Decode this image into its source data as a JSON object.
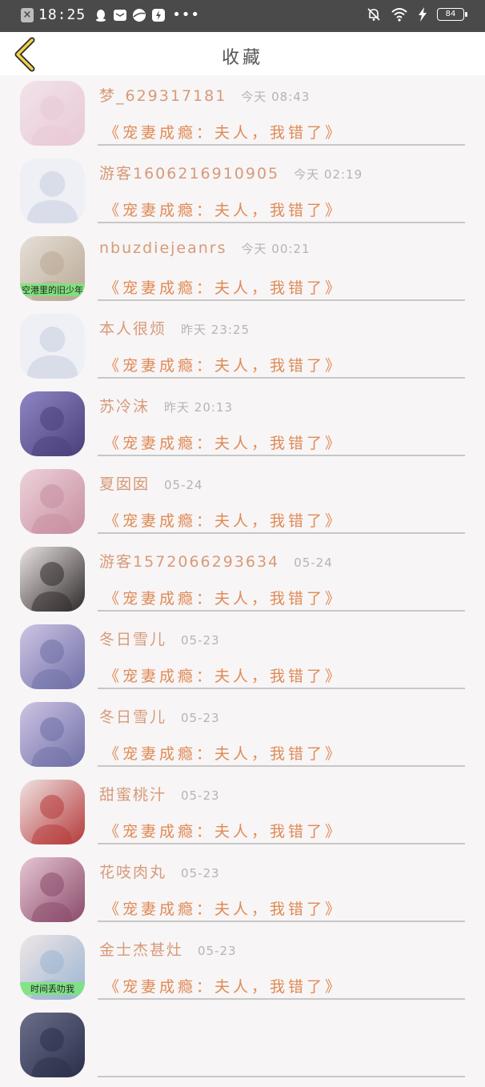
{
  "status_bar": {
    "time": "18:25",
    "battery": "84",
    "left_icons": [
      "close-box-icon",
      "qq-icon",
      "mail-icon",
      "planet-icon",
      "bolt-app-icon",
      "more-dots-icon"
    ],
    "right_icons": [
      "bell-off-icon",
      "wifi-icon",
      "charging-icon",
      "battery-icon"
    ]
  },
  "header": {
    "title": "收藏"
  },
  "items": [
    {
      "name": "梦_629317181",
      "time": "今天 08:43",
      "book": "《宠妻成瘾：夫人，我错了》",
      "avatar": "photo",
      "avatar_colors": [
        "#e8c9d6",
        "#f2e3ea"
      ]
    },
    {
      "name": "游客1606216910905",
      "time": "今天 02:19",
      "book": "《宠妻成瘾：夫人，我错了》",
      "avatar": "default",
      "avatar_colors": [
        "#d9dde9",
        "#eef0f6"
      ]
    },
    {
      "name": "nbuzdiejeanrs",
      "time": "今天 00:21",
      "book": "《宠妻成瘾：夫人，我错了》",
      "avatar": "photo",
      "avatar_colors": [
        "#b9a894",
        "#e6e0d8"
      ],
      "caption": "空港里的旧少年"
    },
    {
      "name": "本人很烦",
      "time": "昨天 23:25",
      "book": "《宠妻成瘾：夫人，我错了》",
      "avatar": "default",
      "avatar_colors": [
        "#d9dde9",
        "#eef0f6"
      ]
    },
    {
      "name": "苏冷沫",
      "time": "昨天 20:13",
      "book": "《宠妻成瘾：夫人，我错了》",
      "avatar": "photo",
      "avatar_colors": [
        "#4a3f7a",
        "#8e86c4"
      ]
    },
    {
      "name": "夏囡囡",
      "time": "05-24",
      "book": "《宠妻成瘾：夫人，我错了》",
      "avatar": "photo",
      "avatar_colors": [
        "#c78ea0",
        "#edd2da"
      ]
    },
    {
      "name": "游客1572066293634",
      "time": "05-24",
      "book": "《宠妻成瘾：夫人，我错了》",
      "avatar": "photo",
      "avatar_colors": [
        "#2f2a2a",
        "#e9e4e2"
      ]
    },
    {
      "name": "冬日雪儿",
      "time": "05-23",
      "book": "《宠妻成瘾：夫人，我错了》",
      "avatar": "photo",
      "avatar_colors": [
        "#6e6fa6",
        "#cfc4e4"
      ]
    },
    {
      "name": "冬日雪儿",
      "time": "05-23",
      "book": "《宠妻成瘾：夫人，我错了》",
      "avatar": "photo",
      "avatar_colors": [
        "#6e6fa6",
        "#cfc4e4"
      ]
    },
    {
      "name": "甜蜜桃汁",
      "time": "05-23",
      "book": "《宠妻成瘾：夫人，我错了》",
      "avatar": "photo",
      "avatar_colors": [
        "#b53a3a",
        "#f0e2e2"
      ]
    },
    {
      "name": "花吱肉丸",
      "time": "05-23",
      "book": "《宠妻成瘾：夫人，我错了》",
      "avatar": "photo",
      "avatar_colors": [
        "#8a4a6a",
        "#e6c6d4"
      ]
    },
    {
      "name": "金士杰甚灶",
      "time": "05-23",
      "book": "《宠妻成瘾：夫人，我错了》",
      "avatar": "photo",
      "avatar_colors": [
        "#9ab4d2",
        "#f0e6e6"
      ],
      "caption": "时间丢叻我"
    },
    {
      "name": "",
      "time": "",
      "book": "",
      "avatar": "photo",
      "avatar_colors": [
        "#2a2f4a",
        "#6b6f8a"
      ]
    }
  ]
}
